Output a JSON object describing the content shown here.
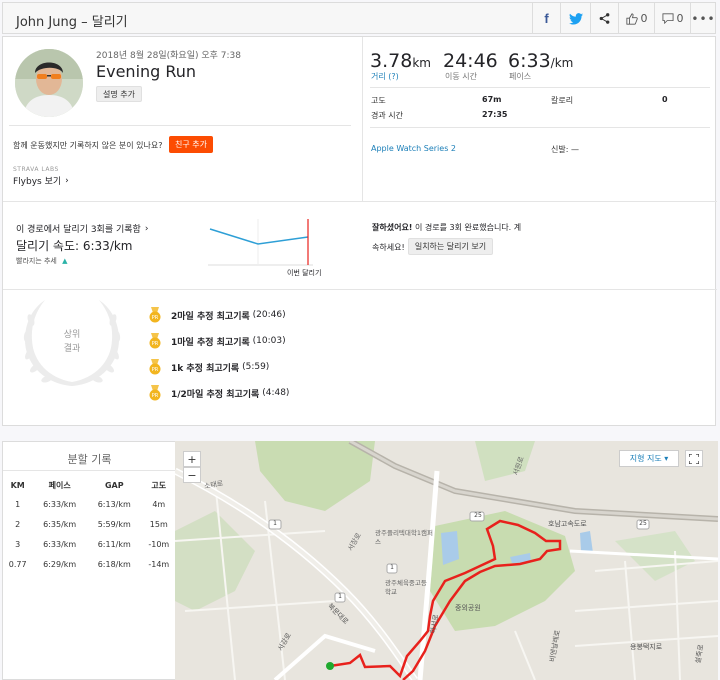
{
  "header": {
    "title": "John Jung – 달리기",
    "likes": "0",
    "comments": "0"
  },
  "activity": {
    "date": "2018년 8월 28일(화요일) 오후 7:38",
    "name": "Evening Run",
    "add_description": "설명 추가",
    "friends_prompt": "함께 운동했지만 기록하지 않은 분이 있나요?",
    "add_friend": "친구 추가",
    "labs": "STRAVA LABS",
    "flybys": "Flybys 보기"
  },
  "stats": {
    "distance_value": "3.78",
    "distance_unit": "km",
    "distance_label": "거리 (?)",
    "moving_time_value": "24:46",
    "moving_time_label": "이동 시간",
    "pace_value": "6:33",
    "pace_unit": "/km",
    "pace_label": "페이스",
    "elevation_label": "고도",
    "elevation_value": "67m",
    "calories_label": "칼로리",
    "calories_value": "0",
    "elapsed_label": "경과 시간",
    "elapsed_value": "27:35",
    "device": "Apple Watch Series 2",
    "shoes_label": "신발: —"
  },
  "segment": {
    "heading": "이 경로에서 달리기 3회를 기록함",
    "speed": "달리기 속도: 6:33/km",
    "trend": "빨라지는 추세",
    "this_run": "이번 달리기",
    "message_bold": "잘하셨어요!",
    "message_rest": " 이 경로를 3회 완료했습니다. 계",
    "message_line2": "속하세요!",
    "match_button": "일치하는 달리기 보기"
  },
  "achievements": {
    "wreath_line1": "상위",
    "wreath_line2": "결과",
    "items": [
      {
        "bold": "2마일 추정 최고기록",
        "time": "(20:46)"
      },
      {
        "bold": "1마일 추정 최고기록",
        "time": "(10:03)"
      },
      {
        "bold": "1k 추정 최고기록",
        "time": "(5:59)"
      },
      {
        "bold": "1/2마일 추정 최고기록",
        "time": "(4:48)"
      }
    ]
  },
  "splits": {
    "title": "분할 기록",
    "headers": [
      "KM",
      "페이스",
      "GAP",
      "고도"
    ],
    "rows": [
      [
        "1",
        "6:33/km",
        "6:13/km",
        "4m"
      ],
      [
        "2",
        "6:35/km",
        "5:59/km",
        "15m"
      ],
      [
        "3",
        "6:33/km",
        "6:11/km",
        "-10m"
      ],
      [
        "0.77",
        "6:29/km",
        "6:18/km",
        "-14m"
      ]
    ]
  },
  "map": {
    "zoom_in": "+",
    "zoom_out": "−",
    "terrain_label": "지형 지도 ▾",
    "labels": {
      "road_top": "서원로",
      "road_left": "소태로",
      "road_mid": "서장로",
      "school": "광주플리텍대학1캠퍼스",
      "sports": "광주체육중고등학교",
      "bukmun": "북문대로",
      "park": "중외공원",
      "seoul": "하서로",
      "expressway": "호남고속도로",
      "seojang": "서강로",
      "bitgoeul": "비엔날레로",
      "bongdong": "용봉택지로",
      "sulliro": "설죽로",
      "num25a": "25",
      "num25b": "25",
      "num1a": "1",
      "num1b": "1",
      "num1c": "1"
    }
  },
  "colors": {
    "brand": "#fc4c02",
    "link": "#1c7fb8",
    "route": "#e8211c",
    "trend_line": "#2e9fd6"
  }
}
